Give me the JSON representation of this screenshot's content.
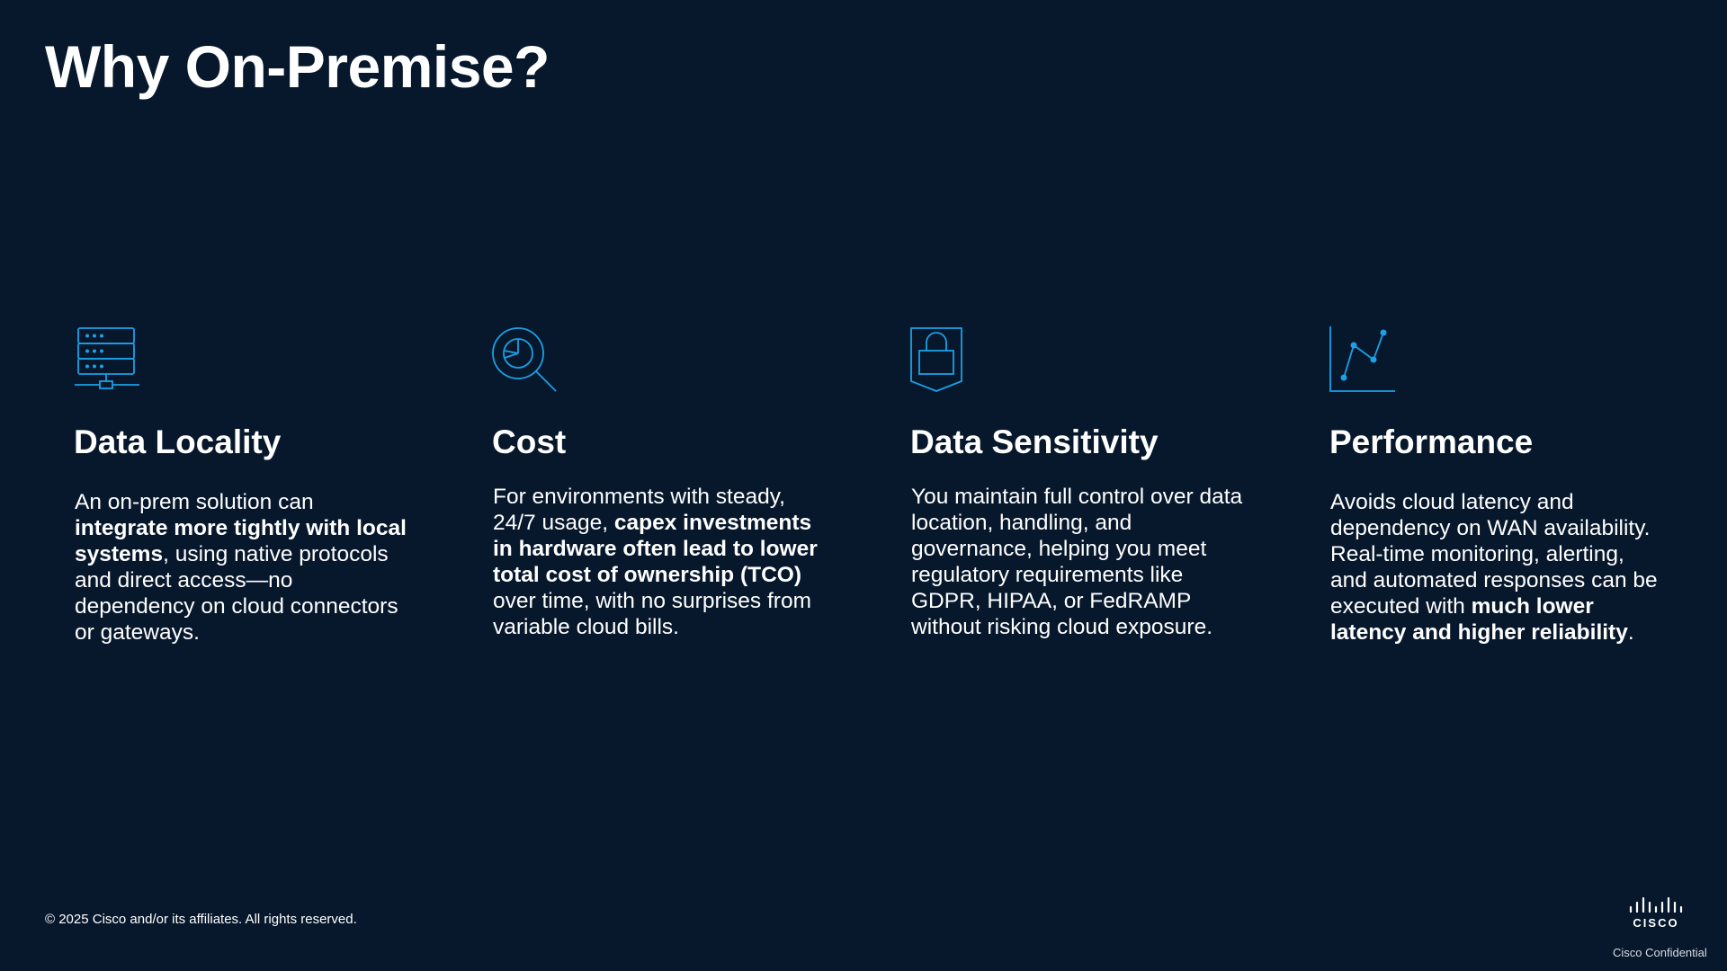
{
  "slide": {
    "title": "Why On-Premise?",
    "accent_color": "#1aa1e6",
    "background_color": "#07182d"
  },
  "columns": [
    {
      "icon": "server-rack-icon",
      "heading": "Data Locality",
      "body": [
        {
          "text": "An on-prem solution can ",
          "bold": false
        },
        {
          "text": "integrate more tightly with local systems",
          "bold": true
        },
        {
          "text": ", using native protocols and direct access—no dependency on cloud connectors or gateways.",
          "bold": false
        }
      ]
    },
    {
      "icon": "magnifier-pie-chart-icon",
      "heading": "Cost",
      "body": [
        {
          "text": "For environments with steady, 24/7 usage, ",
          "bold": false
        },
        {
          "text": "capex investments in hardware often lead to lower total cost of ownership (TCO)",
          "bold": true
        },
        {
          "text": " over time, with no surprises from variable cloud bills.",
          "bold": false
        }
      ]
    },
    {
      "icon": "shield-lock-icon",
      "heading": "Data Sensitivity",
      "body": [
        {
          "text": "You maintain full control over data location, handling, and governance, helping you meet regulatory requirements like GDPR, HIPAA, or FedRAMP without risking cloud exposure.",
          "bold": false
        }
      ]
    },
    {
      "icon": "line-chart-icon",
      "heading": "Performance",
      "body": [
        {
          "text": "Avoids cloud latency and dependency on WAN availability. Real-time monitoring, alerting, and automated responses can be executed with ",
          "bold": false
        },
        {
          "text": "much lower latency and higher reliability",
          "bold": true
        },
        {
          "text": ".",
          "bold": false
        }
      ]
    }
  ],
  "footer": {
    "copyright": "© 2025 Cisco and/or its affiliates. All rights reserved.",
    "logo_text": "CISCO",
    "confidential": "Cisco Confidential"
  }
}
